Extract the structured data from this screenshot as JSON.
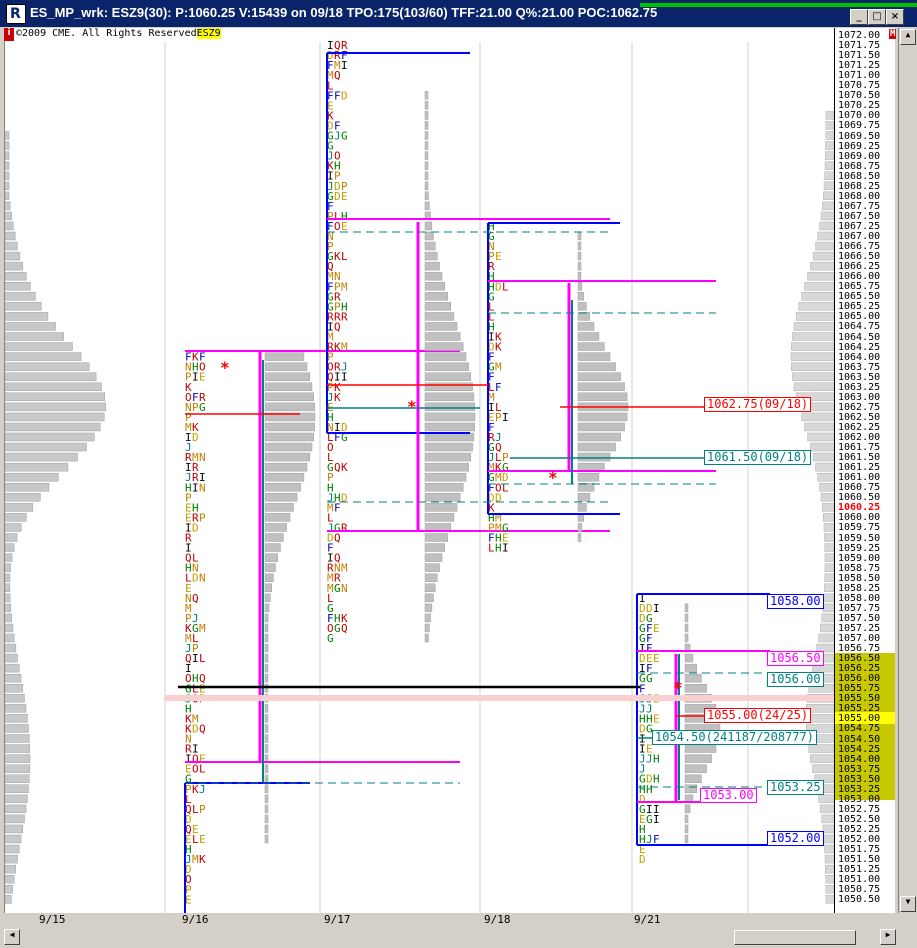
{
  "window": {
    "title": "ES_MP_wrk: ESZ9(30): P:1060.25 V:15439 on 09/18 TPO:175(103/60)  TFF:21.00 Q%:21.00 POC:1062.75",
    "app_icon": "R",
    "copyright": "©2009 CME. All Rights Reserved",
    "symbol_tag": "ESZ9",
    "info_badge": "i",
    "m_badge": "M"
  },
  "colors": {
    "blue": "#0000ff",
    "magenta": "#ff00ff",
    "red": "#ff0000",
    "teal": "#008080",
    "gray_profile": "#c0c0c0",
    "highlight_yellow": "#c8c800",
    "last_price": "#ff0000"
  },
  "price_scale": {
    "labels": [
      "1072.00",
      "1071.75",
      "1071.50",
      "1071.25",
      "1071.00",
      "1070.75",
      "1070.50",
      "1070.25",
      "1070.00",
      "1069.75",
      "1069.50",
      "1069.25",
      "1069.00",
      "1068.75",
      "1068.50",
      "1068.25",
      "1068.00",
      "1067.75",
      "1067.50",
      "1067.25",
      "1067.00",
      "1066.75",
      "1066.50",
      "1066.25",
      "1066.00",
      "1065.75",
      "1065.50",
      "1065.25",
      "1065.00",
      "1064.75",
      "1064.50",
      "1064.25",
      "1064.00",
      "1063.75",
      "1063.50",
      "1063.25",
      "1063.00",
      "1062.75",
      "1062.50",
      "1062.25",
      "1062.00",
      "1061.75",
      "1061.50",
      "1061.25",
      "1061.00",
      "1060.75",
      "1060.50",
      "1060.25",
      "1060.00",
      "1059.75",
      "1059.50",
      "1059.25",
      "1059.00",
      "1058.75",
      "1058.50",
      "1058.25",
      "1058.00",
      "1057.75",
      "1057.50",
      "1057.25",
      "1057.00",
      "1056.75",
      "1056.50",
      "1056.25",
      "1056.00",
      "1055.75",
      "1055.50",
      "1055.25",
      "1055.00",
      "1054.75",
      "1054.50",
      "1054.25",
      "1054.00",
      "1053.75",
      "1053.50",
      "1053.25",
      "1053.00",
      "1052.75",
      "1052.50",
      "1052.25",
      "1052.00",
      "1051.75",
      "1051.50",
      "1051.25",
      "1051.00",
      "1050.75",
      "1050.50"
    ],
    "last_price": "1060.25",
    "current_price": "1055.00"
  },
  "dates": [
    "9/15",
    "9/16",
    "9/17",
    "9/18",
    "9/21"
  ],
  "levels": [
    {
      "text": "1062.75(09/18)",
      "color": "red"
    },
    {
      "text": "1061.50(09/18)",
      "color": "teal"
    },
    {
      "text": "1058.00",
      "color": "blue"
    },
    {
      "text": "1056.50",
      "color": "magenta"
    },
    {
      "text": "1056.00",
      "color": "teal"
    },
    {
      "text": "1055.00(24/25)",
      "color": "red"
    },
    {
      "text": "1054.50(241187/208777)",
      "color": "teal"
    },
    {
      "text": "1053.25",
      "color": "teal"
    },
    {
      "text": "1053.00",
      "color": "magenta"
    },
    {
      "text": "1052.00",
      "color": "blue"
    }
  ],
  "icons": [
    "app-r-icon",
    "minimize-icon",
    "maximize-icon",
    "close-icon",
    "scroll-up-icon",
    "scroll-down-icon",
    "scroll-left-icon",
    "scroll-right-icon"
  ]
}
